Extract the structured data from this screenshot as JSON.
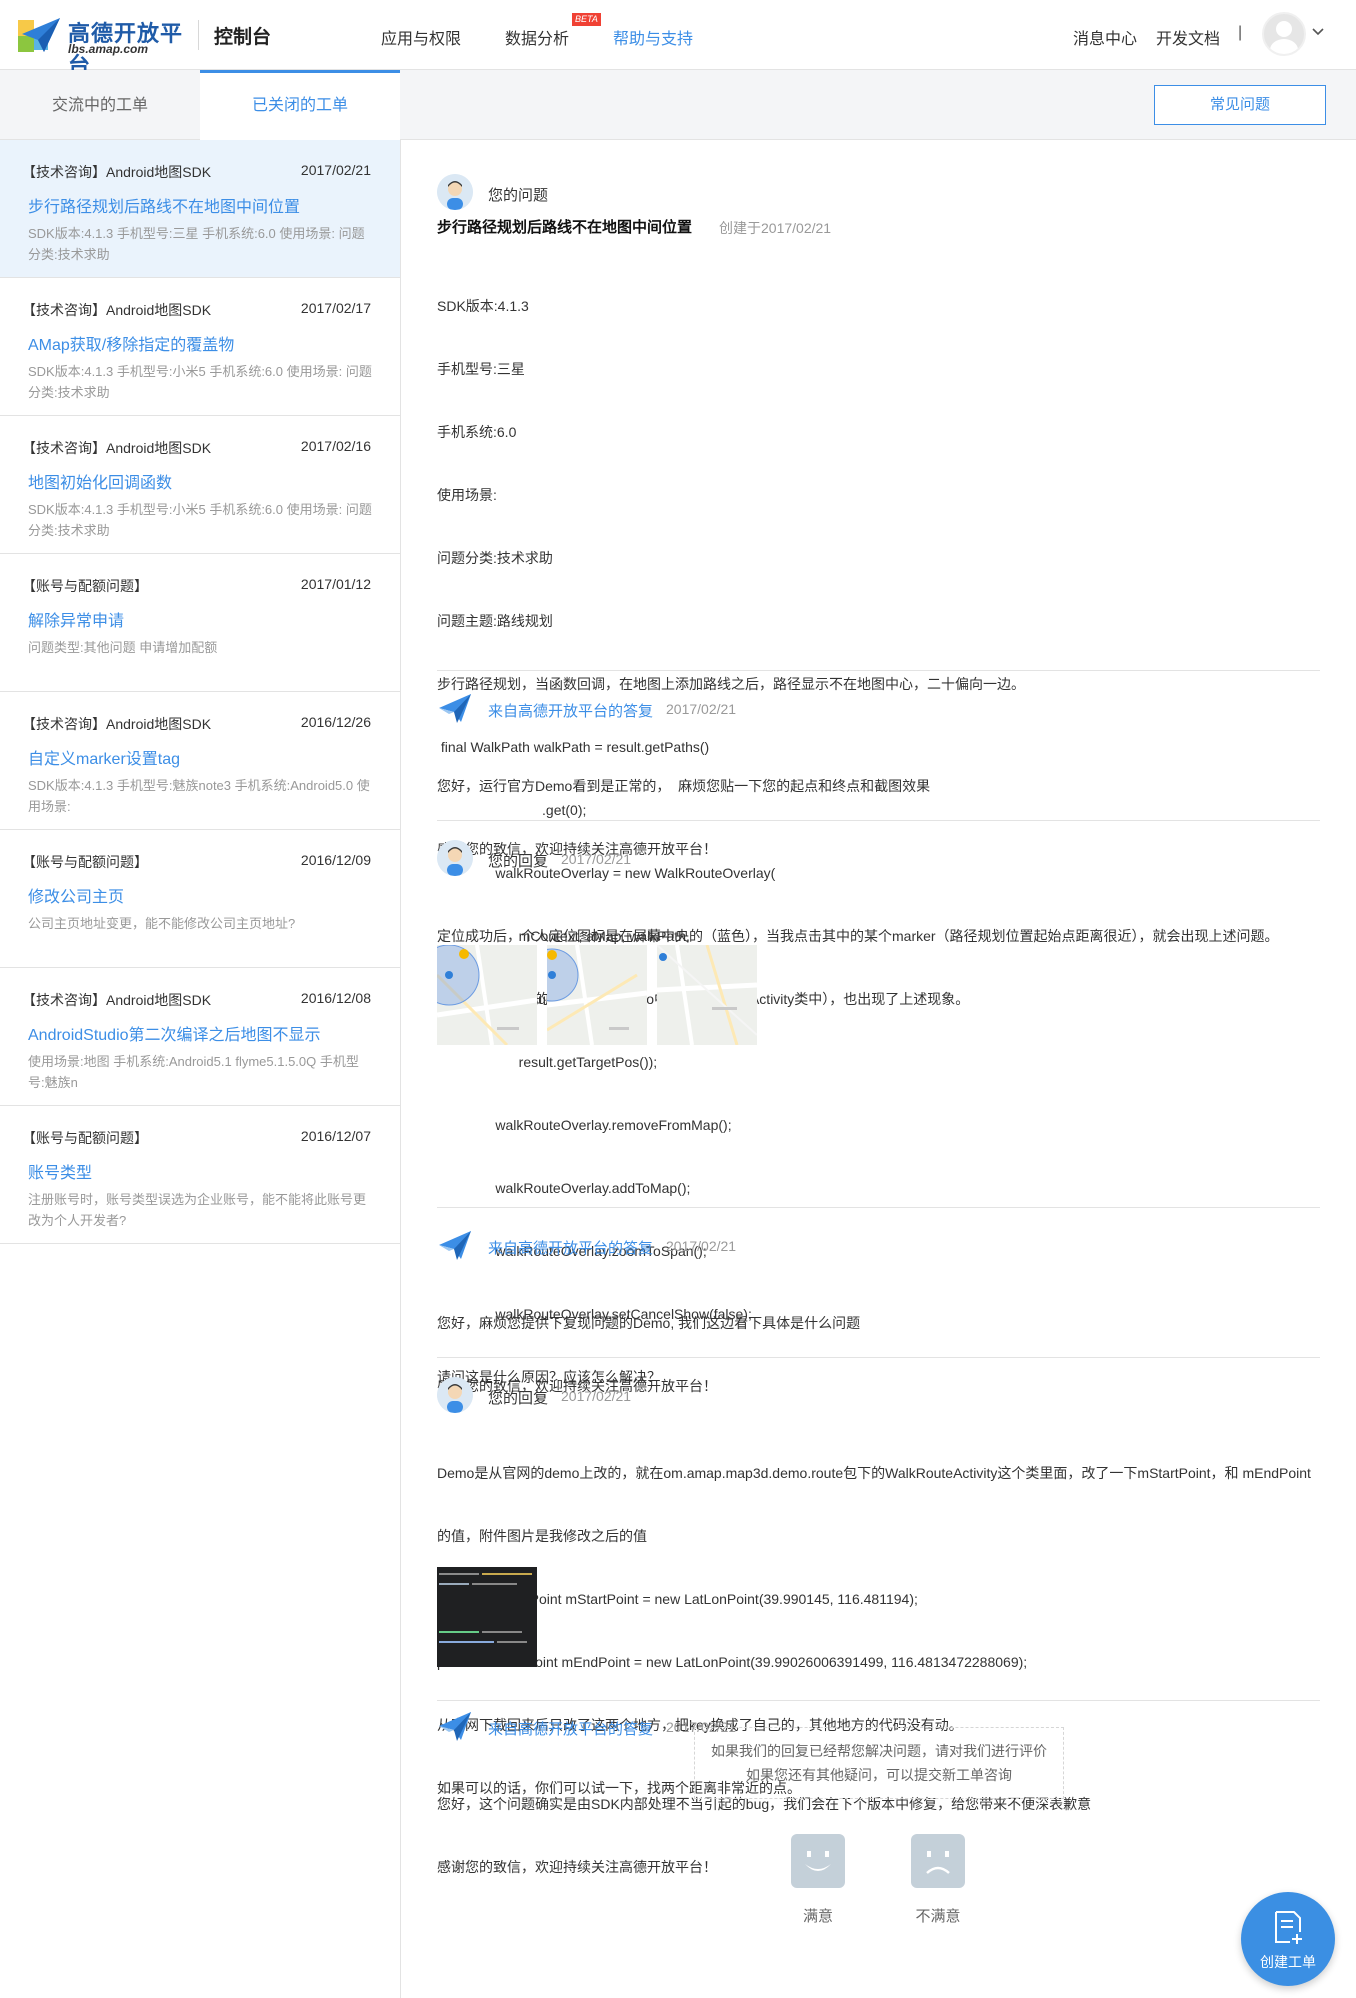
{
  "header": {
    "logo_title": "高德开放平台",
    "logo_subtitle": "lbs.amap.com",
    "console": "控制台",
    "nav": [
      {
        "label": "应用与权限"
      },
      {
        "label": "数据分析",
        "badge": "BETA"
      },
      {
        "label": "帮助与支持"
      }
    ],
    "right_links": {
      "messages": "消息中心",
      "docs": "开发文档",
      "separator": "|"
    }
  },
  "tabs": [
    {
      "label": "交流中的工单"
    },
    {
      "label": "已关闭的工单"
    }
  ],
  "faq_button": "常见问题",
  "tickets": [
    {
      "category": "【技术咨询】Android地图SDK",
      "date": "2017/02/21",
      "title": "步行路径规划后路线不在地图中间位置",
      "desc": "SDK版本:4.1.3 手机型号:三星 手机系统:6.0 使用场景: 问题分类:技术求助"
    },
    {
      "category": "【技术咨询】Android地图SDK",
      "date": "2017/02/17",
      "title": "AMap获取/移除指定的覆盖物",
      "desc": "SDK版本:4.1.3 手机型号:小米5 手机系统:6.0 使用场景: 问题分类:技术求助"
    },
    {
      "category": "【技术咨询】Android地图SDK",
      "date": "2017/02/16",
      "title": "地图初始化回调函数",
      "desc": "SDK版本:4.1.3 手机型号:小米5 手机系统:6.0 使用场景: 问题分类:技术求助"
    },
    {
      "category": "【账号与配额问题】",
      "date": "2017/01/12",
      "title": "解除异常申请",
      "desc": "问题类型:其他问题 申请增加配额"
    },
    {
      "category": "【技术咨询】Android地图SDK",
      "date": "2016/12/26",
      "title": "自定义marker设置tag",
      "desc": "SDK版本:4.1.3 手机型号:魅族note3 手机系统:Android5.0 使用场景:"
    },
    {
      "category": "【账号与配额问题】",
      "date": "2016/12/09",
      "title": "修改公司主页",
      "desc": "公司主页地址变更，能不能修改公司主页地址?"
    },
    {
      "category": "【技术咨询】Android地图SDK",
      "date": "2016/12/08",
      "title": "AndroidStudio第二次编译之后地图不显示",
      "desc": "使用场景:地图 手机系统:Android5.1 flyme5.1.5.0Q 手机型号:魅族n"
    },
    {
      "category": "【账号与配额问题】",
      "date": "2016/12/07",
      "title": "账号类型",
      "desc": "注册账号时，账号类型误选为企业账号，能不能将此账号更改为个人开发者?"
    }
  ],
  "question": {
    "heading": "您的问题",
    "title": "步行路径规划后路线不在地图中间位置",
    "created": "创建于2017/02/21",
    "lines": [
      "SDK版本:4.1.3",
      "手机型号:三星",
      "手机系统:6.0",
      "使用场景:",
      "问题分类:技术求助",
      "问题主题:路线规划",
      "步行路径规划，当函数回调，在地图上添加路线之后，路径显示不在地图中心，二十偏向一边。",
      " final WalkPath walkPath = result.getPaths()",
      "                           .get(0);",
      "               walkRouteOverlay = new WalkRouteOverlay(",
      "                     mContext, aMap, walkPath,",
      "                     result.getStartPos(),",
      "                     result.getTargetPos());",
      "               walkRouteOverlay.removeFromMap();",
      "               walkRouteOverlay.addToMap();",
      "               walkRouteOverlay.zoomToSpan();",
      "               walkRouteOverlay.setCancelShow(false);",
      "请问这是什么原因？应该怎么解决？"
    ]
  },
  "replies": [
    {
      "author": "来自高德开放平台的答复",
      "date": "2017/02/21",
      "lines": [
        "您好，运行官方Demo看到是正常的，  麻烦您贴一下您的起点和终点和截图效果",
        "感谢您的致信，欢迎持续关注高德开放平台！"
      ]
    },
    {
      "author": "您的回复",
      "date": "2017/02/21",
      "lines": [
        "定位成功后，个人定位图标是在屏幕中央的（蓝色），当我点击其中的某个marker（路径规划位置起始点距离很近），就会出现上述问题。",
        "我讲两个坐标点的位置复制到demo中（WalkRouteActivity类中），也出现了上述现象。"
      ]
    },
    {
      "author": "来自高德开放平台的答复",
      "date": "2017/02/21",
      "lines": [
        "您好，麻烦您提供下复现问题的Demo, 我们这边看下具体是什么问题",
        "感谢您的致信，欢迎持续关注高德开放平台！"
      ]
    },
    {
      "author": "您的回复",
      "date": "2017/02/21",
      "lines": [
        "Demo是从官网的demo上改的，就在om.amap.map3d.demo.route包下的WalkRouteActivity这个类里面，改了一下mStartPoint，和 mEndPoint",
        "的值，附件图片是我修改之后的值",
        " private LatLonPoint mStartPoint = new LatLonPoint(39.990145, 116.481194);",
        "private LatLonPoint mEndPoint = new LatLonPoint(39.99026006391499, 116.4813472288069);",
        "从官网下载回来后只改了这两个地方，把key换成了自己的，其他地方的代码没有动。",
        "如果可以的话，你们可以试一下，找两个距离非常近的点。"
      ]
    },
    {
      "author": "来自高德开放平台的答复",
      "date": "2017/02/21",
      "lines": [
        "您好，这个问题确实是由SDK内部处理不当引起的bug，我们会在下个版本中修复，给您带来不便深表歉意",
        "感谢您的致信，欢迎持续关注高德开放平台！"
      ]
    }
  ],
  "evaluation": {
    "line1": "如果我们的回复已经帮您解决问题，请对我们进行评价",
    "line2": "如果您还有其他疑问，可以提交新工单咨询",
    "satisfied": "满意",
    "unsatisfied": "不满意"
  },
  "fab_label": "创建工单",
  "colors": {
    "accent": "#3c8ee6",
    "badge": "#f04134"
  }
}
